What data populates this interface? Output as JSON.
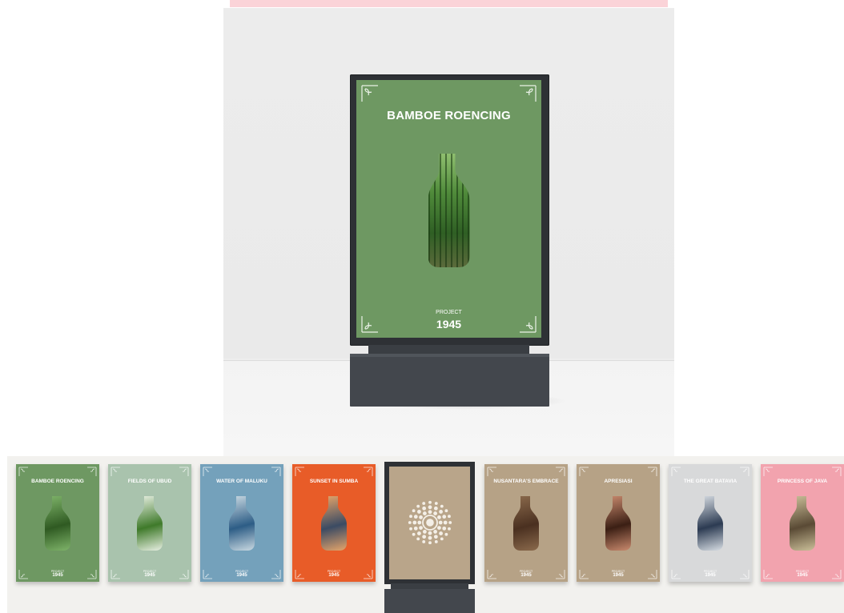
{
  "hero": {
    "title": "BAMBOE ROENCING",
    "project_label": "PROJECT",
    "year": "1945",
    "poster_color": "#6e9862"
  },
  "strip": {
    "thumbnails": [
      {
        "title": "BAMBOE ROENCING",
        "project_label": "PROJECT",
        "year": "1945",
        "color": "#6e9862",
        "bottle_a": "#2f5a22",
        "bottle_b": "#7fb46a"
      },
      {
        "title": "FIELDS OF UBUD",
        "project_label": "PROJECT",
        "year": "1945",
        "color": "#a9c3ad",
        "bottle_a": "#3f7a2a",
        "bottle_b": "#e7efe2"
      },
      {
        "title": "WATER OF MALUKU",
        "project_label": "PROJECT",
        "year": "1945",
        "color": "#74a1bb",
        "bottle_a": "#2d5d86",
        "bottle_b": "#c9d9e2"
      },
      {
        "title": "SUNSET IN SUMBA",
        "project_label": "PROJECT",
        "year": "1945",
        "color": "#e85c28",
        "bottle_a": "#3b4b63",
        "bottle_b": "#e6a56a"
      },
      {
        "title": "NUSANTARA'S EMBRACE",
        "project_label": "PROJECT",
        "year": "1945",
        "color": "#b6a286",
        "bottle_a": "#4a3020",
        "bottle_b": "#8b6a4c"
      },
      {
        "title": "APRESIASI",
        "project_label": "PROJECT",
        "year": "1945",
        "color": "#b6a286",
        "bottle_a": "#3b1f14",
        "bottle_b": "#c98a6e"
      },
      {
        "title": "THE GREAT BATAVIA",
        "project_label": "PROJECT",
        "year": "1945",
        "color": "#d8d9da",
        "bottle_a": "#2c3b52",
        "bottle_b": "#d7dde3"
      },
      {
        "title": "PRINCESS OF JAVA",
        "project_label": "PROJECT",
        "year": "1945",
        "color": "#f2a3ae",
        "bottle_a": "#5a4a35",
        "bottle_b": "#cbbf99"
      }
    ],
    "mini_kiosk": {
      "poster_color": "#b9a58a"
    }
  }
}
